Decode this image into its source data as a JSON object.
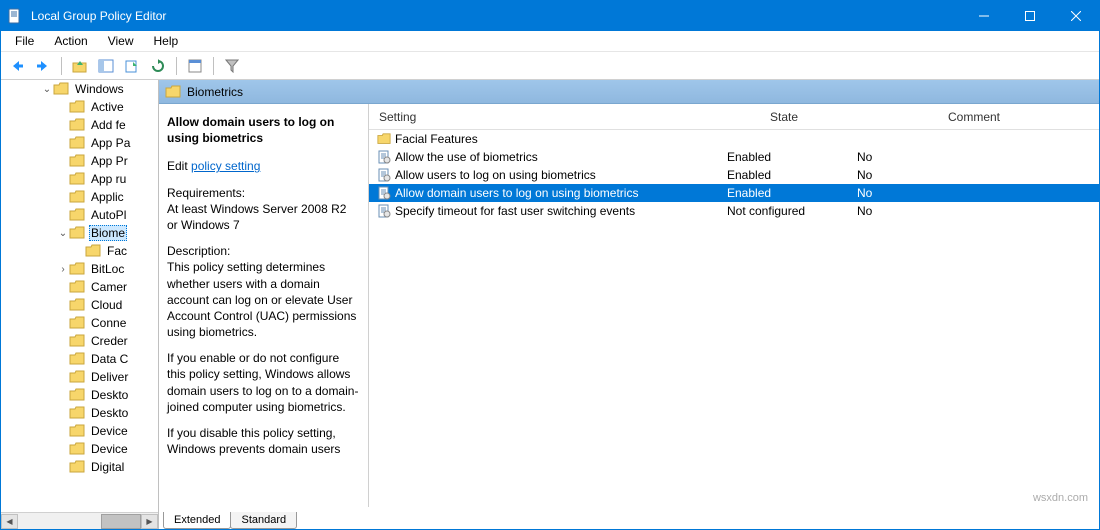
{
  "window": {
    "title": "Local Group Policy Editor"
  },
  "menubar": {
    "items": [
      "File",
      "Action",
      "View",
      "Help"
    ]
  },
  "tree": {
    "top": "Windows",
    "items": [
      {
        "label": "Active",
        "toggle": ""
      },
      {
        "label": "Add fe",
        "toggle": ""
      },
      {
        "label": "App Pa",
        "toggle": ""
      },
      {
        "label": "App Pr",
        "toggle": ""
      },
      {
        "label": "App ru",
        "toggle": ""
      },
      {
        "label": "Applic",
        "toggle": ""
      },
      {
        "label": "AutoPl",
        "toggle": ""
      },
      {
        "label": "Biome",
        "toggle": "v",
        "selected": true,
        "children": [
          {
            "label": "Fac"
          }
        ]
      },
      {
        "label": "BitLoc",
        "toggle": ">"
      },
      {
        "label": "Camer",
        "toggle": ""
      },
      {
        "label": "Cloud",
        "toggle": ""
      },
      {
        "label": "Conne",
        "toggle": ""
      },
      {
        "label": "Creder",
        "toggle": ""
      },
      {
        "label": "Data C",
        "toggle": ""
      },
      {
        "label": "Deliver",
        "toggle": ""
      },
      {
        "label": "Deskto",
        "toggle": ""
      },
      {
        "label": "Deskto",
        "toggle": ""
      },
      {
        "label": "Device",
        "toggle": ""
      },
      {
        "label": "Device",
        "toggle": ""
      },
      {
        "label": "Digital",
        "toggle": ""
      }
    ]
  },
  "content": {
    "header": "Biometrics",
    "extended": {
      "title": "Allow domain users to log on using biometrics",
      "edit_prefix": "Edit ",
      "edit_link": "policy setting",
      "req_label": "Requirements:",
      "req_text": "At least Windows Server 2008 R2 or Windows 7",
      "desc_label": "Description:",
      "desc_1": "This policy setting determines whether users with a domain account can log on or elevate User Account Control (UAC) permissions using biometrics.",
      "desc_2": "If you enable or do not configure this policy setting, Windows allows domain users to log on to a domain-joined computer using biometrics.",
      "desc_3": "If you disable this policy setting, Windows prevents domain users"
    },
    "columns": {
      "setting": "Setting",
      "state": "State",
      "comment": "Comment"
    },
    "rows": [
      {
        "type": "folder",
        "name": "Facial Features",
        "state": "",
        "comment": ""
      },
      {
        "type": "policy",
        "name": "Allow the use of biometrics",
        "state": "Enabled",
        "comment": "No"
      },
      {
        "type": "policy",
        "name": "Allow users to log on using biometrics",
        "state": "Enabled",
        "comment": "No"
      },
      {
        "type": "policy",
        "name": "Allow domain users to log on using biometrics",
        "state": "Enabled",
        "comment": "No",
        "selected": true
      },
      {
        "type": "policy",
        "name": "Specify timeout for fast user switching events",
        "state": "Not configured",
        "comment": "No"
      }
    ],
    "tabs": {
      "extended": "Extended",
      "standard": "Standard"
    }
  },
  "watermark": "wsxdn.com"
}
